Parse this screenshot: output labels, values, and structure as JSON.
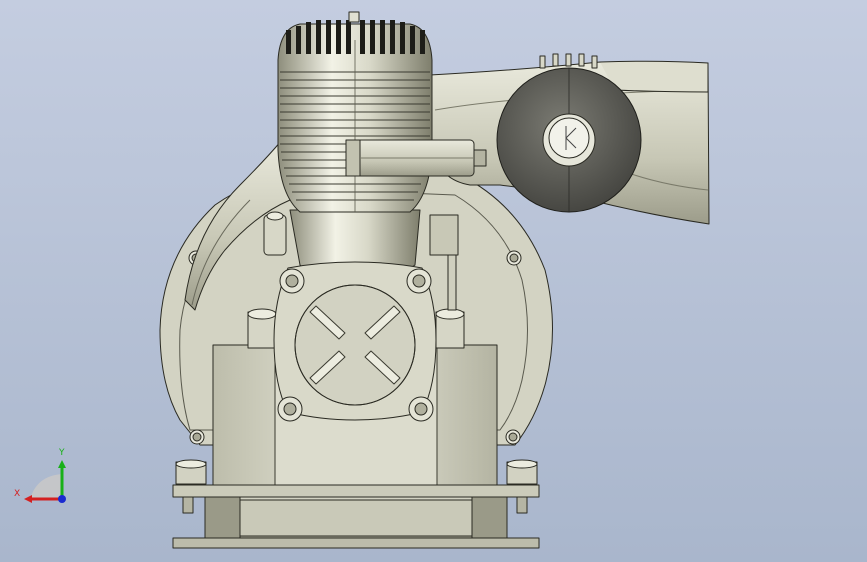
{
  "viewport": {
    "background_top": "#c4cde0",
    "background_bottom": "#a9b6cc"
  },
  "model": {
    "body_color": "#cfcfbe",
    "body_light": "#ececdf",
    "body_dark": "#8e8e7c",
    "outline_color": "#2a2a22",
    "flywheel_color": "#5e5e57",
    "flywheel_dark": "#3a3a36"
  },
  "triad": {
    "x_label": "X",
    "y_label": "Y",
    "x_color": "#d42020",
    "y_color": "#18b018",
    "z_color": "#1a2ad0"
  }
}
